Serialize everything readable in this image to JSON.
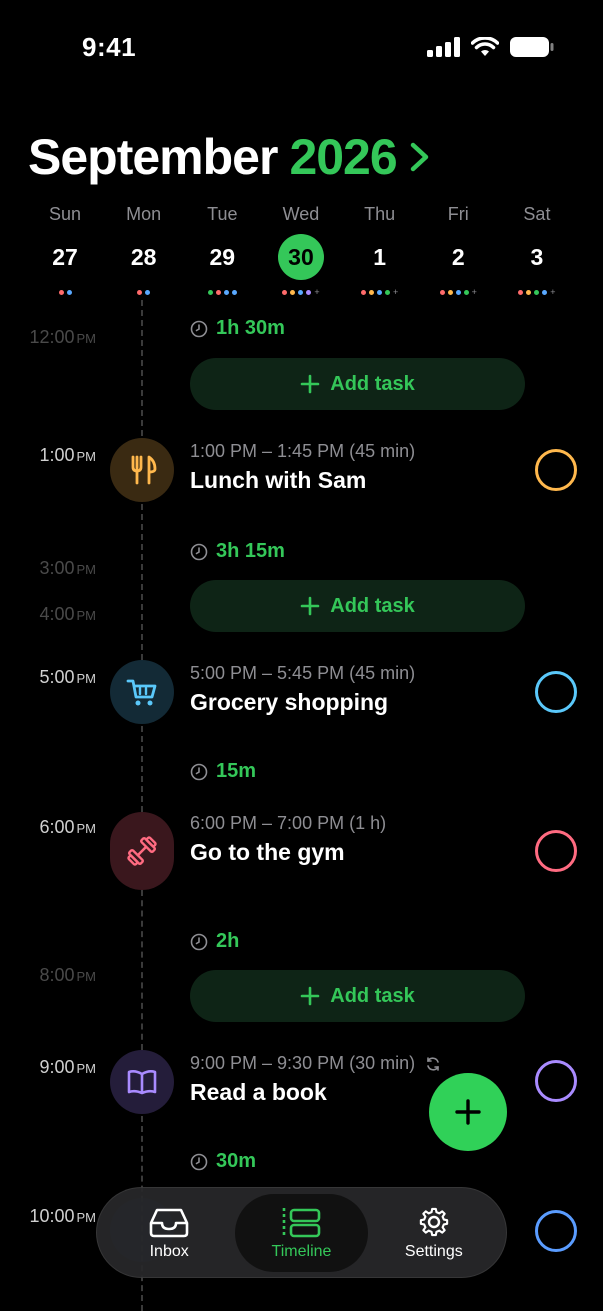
{
  "status": {
    "time": "9:41"
  },
  "header": {
    "month": "September",
    "year": "2026"
  },
  "week": [
    {
      "name": "Sun",
      "num": "27",
      "selected": false,
      "dots": [
        "#ff6b6b",
        "#5aa9ff"
      ],
      "more": false
    },
    {
      "name": "Mon",
      "num": "28",
      "selected": false,
      "dots": [
        "#ff6b6b",
        "#5aa9ff"
      ],
      "more": false
    },
    {
      "name": "Tue",
      "num": "29",
      "selected": false,
      "dots": [
        "#34c759",
        "#ff6b6b",
        "#5aa9ff",
        "#5aa9ff"
      ],
      "more": false
    },
    {
      "name": "Wed",
      "num": "30",
      "selected": true,
      "dots": [
        "#ff6b6b",
        "#ffb84d",
        "#5aa9ff",
        "#a98bff"
      ],
      "more": true
    },
    {
      "name": "Thu",
      "num": "1",
      "selected": false,
      "dots": [
        "#ff6b6b",
        "#ffb84d",
        "#5aa9ff",
        "#34c759"
      ],
      "more": true
    },
    {
      "name": "Fri",
      "num": "2",
      "selected": false,
      "dots": [
        "#ff6b6b",
        "#ffb84d",
        "#5aa9ff",
        "#34c759"
      ],
      "more": true
    },
    {
      "name": "Sat",
      "num": "3",
      "selected": false,
      "dots": [
        "#ff6b6b",
        "#ffb84d",
        "#34c759",
        "#5aa9ff"
      ],
      "more": true
    }
  ],
  "timeline": {
    "labels": [
      {
        "time": "12:00",
        "ampm": "PM",
        "dim": true
      },
      {
        "time": "1:00",
        "ampm": "PM",
        "dim": false
      },
      {
        "time": "3:00",
        "ampm": "PM",
        "dim": true
      },
      {
        "time": "4:00",
        "ampm": "PM",
        "dim": true
      },
      {
        "time": "5:00",
        "ampm": "PM",
        "dim": false
      },
      {
        "time": "6:00",
        "ampm": "PM",
        "dim": false
      },
      {
        "time": "8:00",
        "ampm": "PM",
        "dim": true
      },
      {
        "time": "9:00",
        "ampm": "PM",
        "dim": false
      },
      {
        "time": "10:00",
        "ampm": "PM",
        "dim": false
      }
    ],
    "gaps": [
      "1h 30m",
      "3h 15m",
      "15m",
      "2h",
      "30m"
    ],
    "add_task_label": "Add task",
    "events": [
      {
        "meta": "1:00 PM – 1:45 PM (45 min)",
        "title": "Lunch with Sam",
        "icon": "fork-knife-icon",
        "color": "#ffb84d",
        "bg": "#3a2a12"
      },
      {
        "meta": "5:00 PM – 5:45 PM (45 min)",
        "title": "Grocery shopping",
        "icon": "cart-icon",
        "color": "#5ac8fa",
        "bg": "#132a36"
      },
      {
        "meta": "6:00 PM – 7:00 PM (1 h)",
        "title": "Go to the gym",
        "icon": "dumbbell-icon",
        "color": "#ff6b81",
        "bg": "#3a171d"
      },
      {
        "meta": "9:00 PM – 9:30 PM (30 min)",
        "title": "Read a book",
        "icon": "book-icon",
        "color": "#a98bff",
        "bg": "#241d3a"
      }
    ],
    "last_check_color": "#5a9cff"
  },
  "tabs": [
    {
      "label": "Inbox",
      "icon": "inbox-icon",
      "active": false
    },
    {
      "label": "Timeline",
      "icon": "timeline-icon",
      "active": true
    },
    {
      "label": "Settings",
      "icon": "gear-icon",
      "active": false
    }
  ],
  "colors": {
    "accent": "#34c759",
    "background": "#000000"
  }
}
